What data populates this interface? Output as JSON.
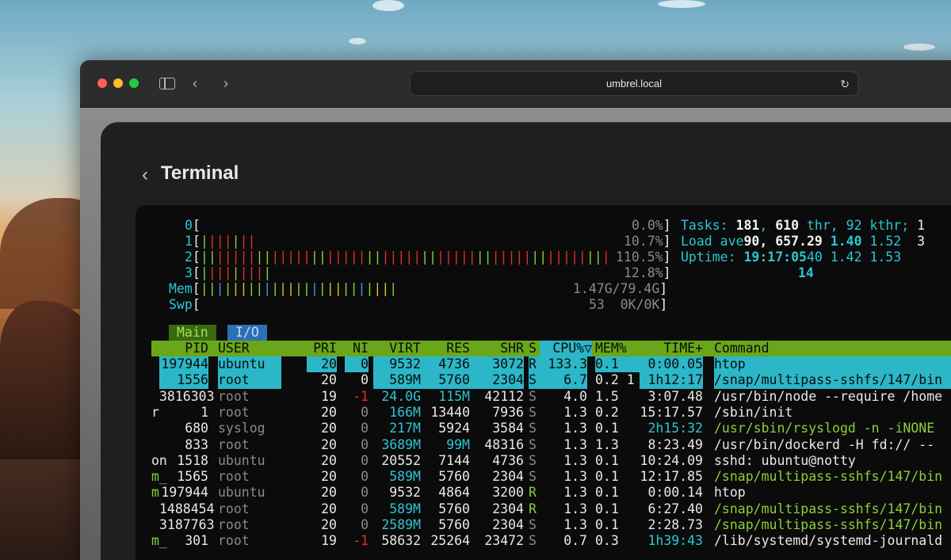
{
  "browser": {
    "url": "umbrel.local"
  },
  "app": {
    "title": "Terminal"
  },
  "htop": {
    "cpus": [
      {
        "label": "0",
        "pct": "0.0%"
      },
      {
        "label": "1",
        "pct": "10.7%"
      },
      {
        "label": "2",
        "pct": "110.5%"
      },
      {
        "label": "3",
        "pct": "12.8%"
      }
    ],
    "mem": {
      "label": "Mem",
      "value": "1.47G/79.4G"
    },
    "swp": {
      "label": "Swp",
      "value": "53  0K/0K"
    },
    "tasks": {
      "label": "Tasks:",
      "count": "181",
      "thr": "610",
      "thr_label": "thr,",
      "kthr": "92",
      "kthr_label": "kthr;",
      "running": "1"
    },
    "load": {
      "label": "Load ave",
      "v1": "90,",
      "v2": "657.29",
      "v3": "1.40",
      "v4": "1.52",
      "v5": "3"
    },
    "uptime": {
      "label": "Uptime:",
      "value": "19:17:05",
      "extra": "40 1.42 1.53",
      "below": "14"
    },
    "tabs": {
      "main": "Main",
      "io": "I/O"
    },
    "header": {
      "pid": "PID",
      "user": "USER",
      "pri": "PRI",
      "ni": "NI",
      "virt": "VIRT",
      "res": "RES",
      "shr": "SHR",
      "s": "S",
      "cpu": "CPU%▽",
      "mem": "MEM%",
      "time": "TIME+",
      "command": "Command"
    },
    "processes": [
      {
        "prefix": "",
        "pid": "197944",
        "user": "ubuntu",
        "pri": "20",
        "ni": "0",
        "virt": "9532",
        "res": "4736",
        "shr": "3072",
        "s": "R",
        "cpu": "133.3",
        "mem": "0.1",
        "time": "0:00.05",
        "cmd": "htop"
      },
      {
        "prefix": "",
        "pid": "1556",
        "user": "root",
        "pri": "20",
        "ni": "0",
        "virt": "589M",
        "res": "5760",
        "shr": "2304",
        "s": "S",
        "cpu": "6.7",
        "mem": "0.2 1",
        "time": "1h12:17",
        "cmd": "/snap/multipass-sshfs/147/bin"
      },
      {
        "prefix": "",
        "pid": "3816303",
        "user": "root",
        "pri": "19",
        "ni": "-1",
        "virt": "24.0G",
        "res": "115M",
        "shr": "42112",
        "s": "S",
        "cpu": "4.0",
        "mem": "1.5",
        "time": "3:07.48",
        "cmd": "/usr/bin/node --require /home"
      },
      {
        "prefix": "r",
        "pid": "1",
        "user": "root",
        "pri": "20",
        "ni": "0",
        "virt": "166M",
        "res": "13440",
        "shr": "7936",
        "s": "S",
        "cpu": "1.3",
        "mem": "0.2",
        "time": "15:17.57",
        "cmd": "/sbin/init"
      },
      {
        "prefix": "",
        "pid": "680",
        "user": "syslog",
        "pri": "20",
        "ni": "0",
        "virt": "217M",
        "res": "5924",
        "shr": "3584",
        "s": "S",
        "cpu": "1.3",
        "mem": "0.1",
        "time": "2h15:32",
        "cmd": "/usr/sbin/rsyslogd -n -iNONE"
      },
      {
        "prefix": "",
        "pid": "833",
        "user": "root",
        "pri": "20",
        "ni": "0",
        "virt": "3689M",
        "res": "99M",
        "shr": "48316",
        "s": "S",
        "cpu": "1.3",
        "mem": "1.3",
        "time": "8:23.49",
        "cmd": "/usr/bin/dockerd -H fd:// --"
      },
      {
        "prefix": "on",
        "pid": "1518",
        "user": "ubuntu",
        "pri": "20",
        "ni": "0",
        "virt": "20552",
        "res": "7144",
        "shr": "4736",
        "s": "S",
        "cpu": "1.3",
        "mem": "0.1",
        "time": "10:24.09",
        "cmd": "sshd: ubuntu@notty"
      },
      {
        "prefix": "m_",
        "pid": "1565",
        "user": "root",
        "pri": "20",
        "ni": "0",
        "virt": "589M",
        "res": "5760",
        "shr": "2304",
        "s": "S",
        "cpu": "1.3",
        "mem": "0.1",
        "time": "12:17.85",
        "cmd": "/snap/multipass-sshfs/147/bin"
      },
      {
        "prefix": "m",
        "pid": "197944",
        "user": "ubuntu",
        "pri": "20",
        "ni": "0",
        "virt": "9532",
        "res": "4864",
        "shr": "3200",
        "s": "R",
        "cpu": "1.3",
        "mem": "0.1",
        "time": "0:00.14",
        "cmd": "htop"
      },
      {
        "prefix": "",
        "pid": "1488454",
        "user": "root",
        "pri": "20",
        "ni": "0",
        "virt": "589M",
        "res": "5760",
        "shr": "2304",
        "s": "R",
        "cpu": "1.3",
        "mem": "0.1",
        "time": "6:27.40",
        "cmd": "/snap/multipass-sshfs/147/bin"
      },
      {
        "prefix": "",
        "pid": "3187763",
        "user": "root",
        "pri": "20",
        "ni": "0",
        "virt": "2589M",
        "res": "5760",
        "shr": "2304",
        "s": "S",
        "cpu": "1.3",
        "mem": "0.1",
        "time": "2:28.73",
        "cmd": "/snap/multipass-sshfs/147/bin"
      },
      {
        "prefix": "m_",
        "pid": "301",
        "user": "root",
        "pri": "19",
        "ni": "-1",
        "virt": "58632",
        "res": "25264",
        "shr": "23472",
        "s": "S",
        "cpu": "0.7",
        "mem": "0.3",
        "time": "1h39:43",
        "cmd": "/lib/systemd/systemd-journald"
      }
    ]
  }
}
